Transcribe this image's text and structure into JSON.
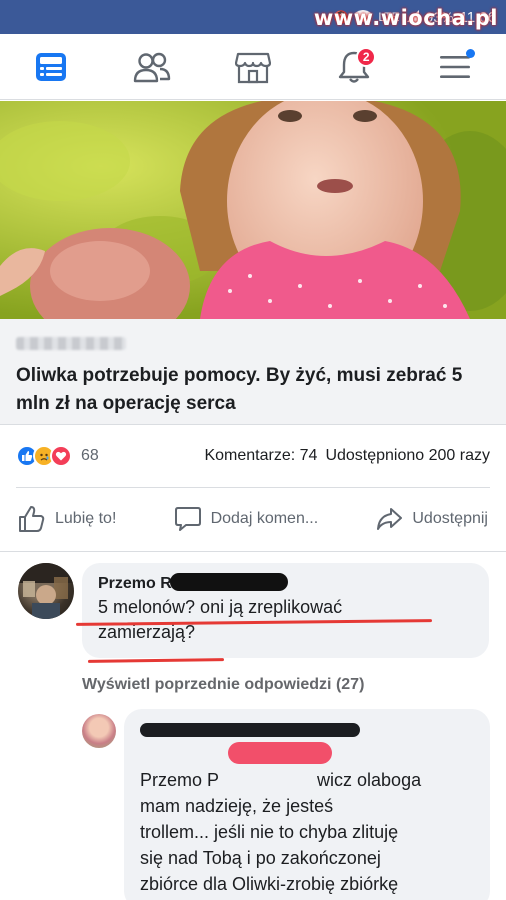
{
  "status_bar": {
    "signal_label": "LTE",
    "battery": "93%",
    "time": "11:06",
    "watermark": "www.wiocha.pl"
  },
  "nav": {
    "items": [
      {
        "name": "news-feed",
        "active": true
      },
      {
        "name": "friends"
      },
      {
        "name": "marketplace"
      },
      {
        "name": "notifications",
        "badge": "2"
      },
      {
        "name": "menu",
        "has_dot": true
      }
    ],
    "active_color": "#1877f2",
    "icon_color": "#606770"
  },
  "post": {
    "link_title": "Oliwka potrzebuje pomocy. By żyć, musi zebrać 5 mln zł na operację serca",
    "reactions_count": "68",
    "comments_label": "Komentarze: 74",
    "shares_label": "Udostępniono 200 razy",
    "actions": {
      "like": "Lubię to!",
      "comment": "Dodaj komen...",
      "share": "Udostępnij"
    }
  },
  "comments": {
    "first": {
      "author": "Przemo R",
      "text_line1": "5 melonów? oni ją zreplikować",
      "text_line2": "zamierzają?"
    },
    "view_replies": "Wyświetl poprzednie odpowiedzi (27)",
    "reply": {
      "text_line1_start": "Przemo P",
      "text_line1_end": "wicz olaboga",
      "text_rest": "mam nadzieję, że jesteś\ntrollem... jeśli nie to chyba zlituję\nsię nad Tobą i po zakończonej\nzbiórce dla Oliwki-zrobię zbiórkę\ndla Ciebie.Ewidentnie trzeba Ci"
    }
  }
}
